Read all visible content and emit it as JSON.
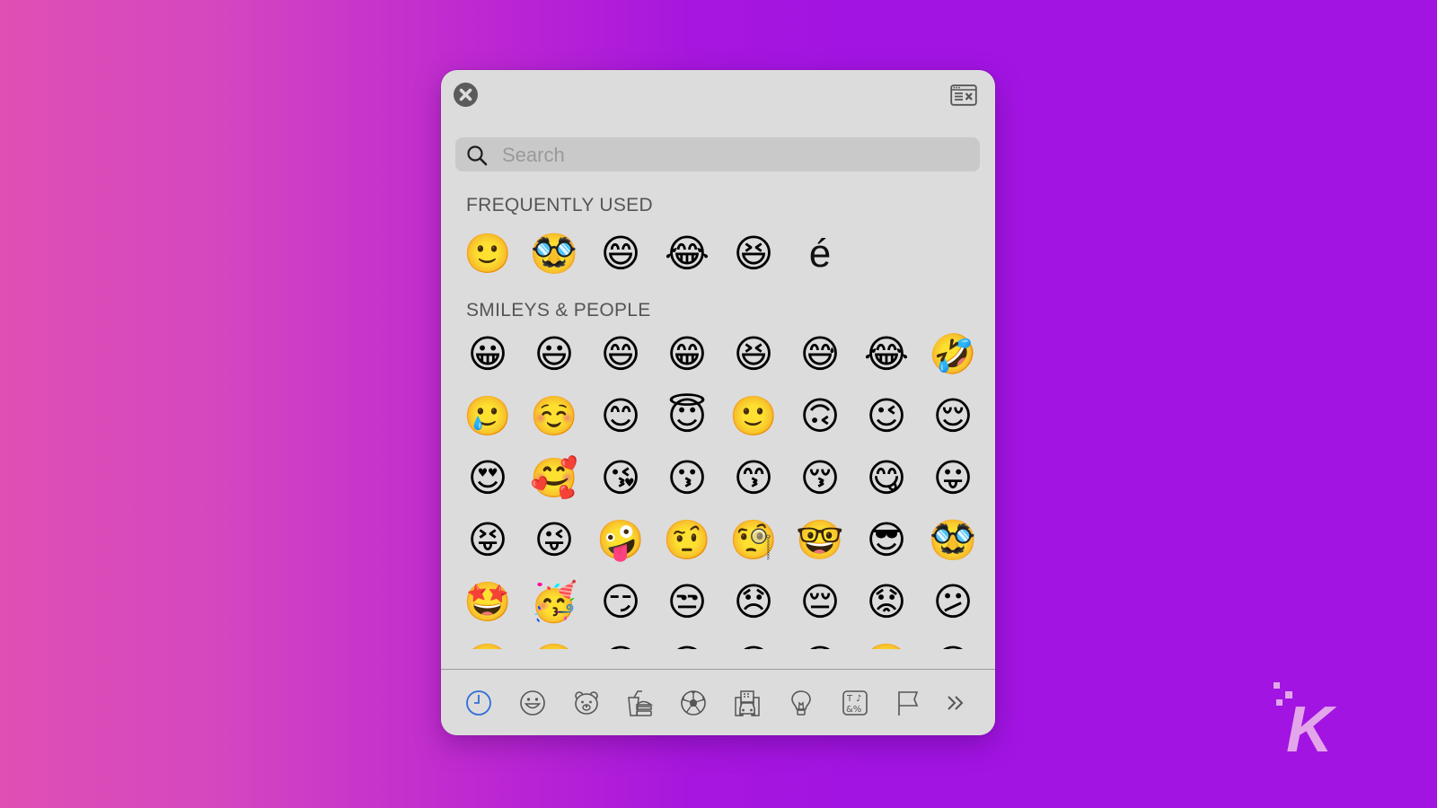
{
  "window": {
    "close_icon": "close-icon",
    "character_viewer_icon": "character-viewer-icon"
  },
  "search": {
    "placeholder": "Search",
    "value": "",
    "icon": "search-icon"
  },
  "sections": [
    {
      "title": "FREQUENTLY USED",
      "items": [
        {
          "char": "🙂",
          "name": "slightly-smiling-face"
        },
        {
          "char": "🥸",
          "name": "disguised-face"
        },
        {
          "char": "😄",
          "name": "grinning-face-with-smiling-eyes"
        },
        {
          "char": "😂",
          "name": "face-with-tears-of-joy"
        },
        {
          "char": "😆",
          "name": "grinning-squinting-face"
        },
        {
          "char": "é",
          "name": "latin-small-letter-e-acute"
        }
      ]
    },
    {
      "title": "SMILEYS & PEOPLE",
      "items": [
        {
          "char": "😀",
          "name": "grinning-face"
        },
        {
          "char": "😃",
          "name": "grinning-face-with-big-eyes"
        },
        {
          "char": "😄",
          "name": "grinning-face-with-smiling-eyes"
        },
        {
          "char": "😁",
          "name": "beaming-face"
        },
        {
          "char": "😆",
          "name": "grinning-squinting-face"
        },
        {
          "char": "😅",
          "name": "grinning-face-with-sweat"
        },
        {
          "char": "😂",
          "name": "face-with-tears-of-joy"
        },
        {
          "char": "🤣",
          "name": "rolling-on-floor-laughing"
        },
        {
          "char": "🥲",
          "name": "smiling-face-with-tear"
        },
        {
          "char": "☺️",
          "name": "smiling-face"
        },
        {
          "char": "😊",
          "name": "smiling-face-with-smiling-eyes"
        },
        {
          "char": "😇",
          "name": "smiling-face-with-halo"
        },
        {
          "char": "🙂",
          "name": "slightly-smiling-face"
        },
        {
          "char": "🙃",
          "name": "upside-down-face"
        },
        {
          "char": "😉",
          "name": "winking-face"
        },
        {
          "char": "😌",
          "name": "relieved-face"
        },
        {
          "char": "😍",
          "name": "smiling-face-with-heart-eyes"
        },
        {
          "char": "🥰",
          "name": "smiling-face-with-hearts"
        },
        {
          "char": "😘",
          "name": "face-blowing-a-kiss"
        },
        {
          "char": "😗",
          "name": "kissing-face"
        },
        {
          "char": "😙",
          "name": "kissing-face-with-smiling-eyes"
        },
        {
          "char": "😚",
          "name": "kissing-face-with-closed-eyes"
        },
        {
          "char": "😋",
          "name": "face-savoring-food"
        },
        {
          "char": "😛",
          "name": "face-with-tongue"
        },
        {
          "char": "😝",
          "name": "squinting-face-with-tongue"
        },
        {
          "char": "😜",
          "name": "winking-face-with-tongue"
        },
        {
          "char": "🤪",
          "name": "zany-face"
        },
        {
          "char": "🤨",
          "name": "face-with-raised-eyebrow"
        },
        {
          "char": "🧐",
          "name": "face-with-monocle"
        },
        {
          "char": "🤓",
          "name": "nerd-face"
        },
        {
          "char": "😎",
          "name": "smiling-face-with-sunglasses"
        },
        {
          "char": "🥸",
          "name": "disguised-face"
        },
        {
          "char": "🤩",
          "name": "star-struck"
        },
        {
          "char": "🥳",
          "name": "partying-face"
        },
        {
          "char": "😏",
          "name": "smirking-face"
        },
        {
          "char": "😒",
          "name": "unamused-face"
        },
        {
          "char": "😞",
          "name": "disappointed-face"
        },
        {
          "char": "😔",
          "name": "pensive-face"
        },
        {
          "char": "😟",
          "name": "worried-face"
        },
        {
          "char": "😕",
          "name": "confused-face"
        },
        {
          "char": "🙁",
          "name": "slightly-frowning-face"
        },
        {
          "char": "☹️",
          "name": "frowning-face"
        },
        {
          "char": "😣",
          "name": "persevering-face"
        },
        {
          "char": "😖",
          "name": "confounded-face"
        },
        {
          "char": "😫",
          "name": "tired-face"
        },
        {
          "char": "😩",
          "name": "weary-face"
        },
        {
          "char": "🥺",
          "name": "pleading-face"
        },
        {
          "char": "😢",
          "name": "crying-face"
        }
      ]
    }
  ],
  "category_tabs": [
    {
      "name": "frequently-used",
      "icon": "clock-icon",
      "selected": true
    },
    {
      "name": "smileys-people",
      "icon": "smiley-icon",
      "selected": false
    },
    {
      "name": "animals-nature",
      "icon": "bear-icon",
      "selected": false
    },
    {
      "name": "food-drink",
      "icon": "burger-drink-icon",
      "selected": false
    },
    {
      "name": "activity",
      "icon": "soccer-ball-icon",
      "selected": false
    },
    {
      "name": "travel-places",
      "icon": "car-building-icon",
      "selected": false
    },
    {
      "name": "objects",
      "icon": "lightbulb-icon",
      "selected": false
    },
    {
      "name": "symbols",
      "icon": "symbols-icon",
      "selected": false
    },
    {
      "name": "flags",
      "icon": "flag-icon",
      "selected": false
    },
    {
      "name": "more",
      "icon": "double-chevron-right-icon",
      "selected": false
    }
  ],
  "colors": {
    "background_left": "#e04fb4",
    "background_right": "#a214e2",
    "panel": "#dcdcdc",
    "search_field": "#c9c9c9",
    "selected_tab": "#2f6fd6",
    "icon_gray": "#5b5b5b"
  },
  "watermark": {
    "letter": "K",
    "name": "knowtechie-logo"
  }
}
